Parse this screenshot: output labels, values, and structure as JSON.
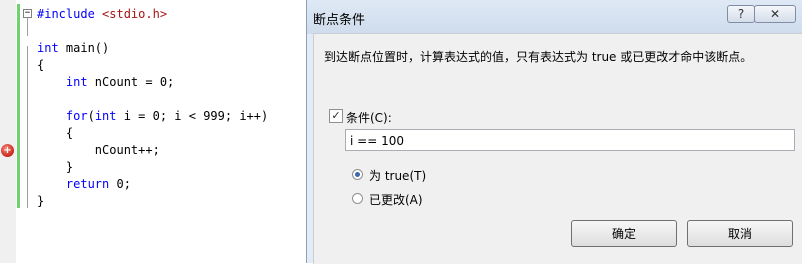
{
  "editor": {
    "lines": [
      {
        "k": "#include",
        "s": "<stdio.h>",
        "t": ""
      },
      {
        "t": ""
      },
      {
        "k": "int",
        "t": " main()"
      },
      {
        "t": "{"
      },
      {
        "k": "    int",
        "t": " nCount = 0;"
      },
      {
        "t": ""
      },
      {
        "k": "    for",
        "t": "(",
        "k2": "int",
        "t2": " i = 0; i < 999; i++)"
      },
      {
        "t": "    {"
      },
      {
        "t": "        nCount++;"
      },
      {
        "t": "    }"
      },
      {
        "k": "    return",
        "t": " 0;"
      },
      {
        "t": "}"
      }
    ],
    "outline_toggle": "−",
    "breakpoint_glyph": "+"
  },
  "dialog": {
    "title": "断点条件",
    "help_label": "?",
    "close_label": "✕",
    "description": "到达断点位置时，计算表达式的值，只有表达式为 true 或已更改才命中该断点。",
    "condition_checkbox_label": "条件(C):",
    "condition_checked": true,
    "condition_value": "i == 100",
    "option_true_label": "为 true(T)",
    "option_changed_label": "已更改(A)",
    "selected_option": "true",
    "ok_label": "确定",
    "cancel_label": "取消",
    "check_glyph": "✓"
  }
}
